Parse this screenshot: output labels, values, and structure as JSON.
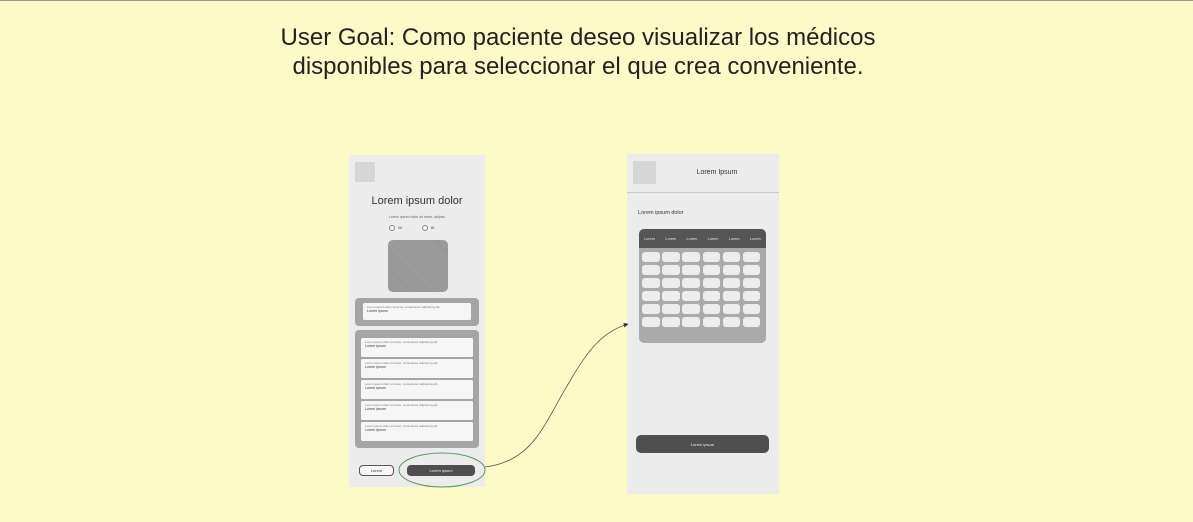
{
  "goal_text": "User Goal: Como paciente deseo visualizar los médicos disponibles para seleccionar el que crea conveniente.",
  "screen_a": {
    "title": "Lorem ipsum dolor",
    "subtitle": "Lorem ipsum dolor sit amet, adipisc",
    "radios": [
      "Iltt",
      "Iltt"
    ],
    "selected_card": {
      "small": "Lorem ipsum dolor sit amet, consectetur adipiscing elit.",
      "main": "Lorem ipsum"
    },
    "list_items": [
      {
        "small": "Lorem ipsum dolor sit amet, consectetur adipiscing elit.",
        "main": "Lorem ipsum"
      },
      {
        "small": "Lorem ipsum dolor sit amet, consectetur adipiscing elit.",
        "main": "Lorem ipsum"
      },
      {
        "small": "Lorem ipsum dolor sit amet, consectetur adipiscing elit.",
        "main": "Lorem ipsum"
      },
      {
        "small": "Lorem ipsum dolor sit amet, consectetur adipiscing elit.",
        "main": "Lorem ipsum"
      },
      {
        "small": "Lorem ipsum dolor sit amet, consectetur adipiscing elit.",
        "main": "Lorem ipsum"
      }
    ],
    "secondary_button": "Lorem",
    "primary_button": "Lorem ipsum"
  },
  "screen_b": {
    "header_title": "Lorem Ipsum",
    "section_label": "Lorem ipsum dolor",
    "grid_headers": [
      "Lorem",
      "Lorem",
      "Lorem",
      "Lorem",
      "Lorem",
      "Lorem"
    ],
    "grid_rows": 6,
    "grid_cols": 6,
    "primary_button": "Lorem ipsum"
  },
  "colors": {
    "background": "#fdfac8",
    "frame": "#ececec",
    "dark": "#4f4f4f",
    "connector_highlight": "#5a9a5a"
  }
}
